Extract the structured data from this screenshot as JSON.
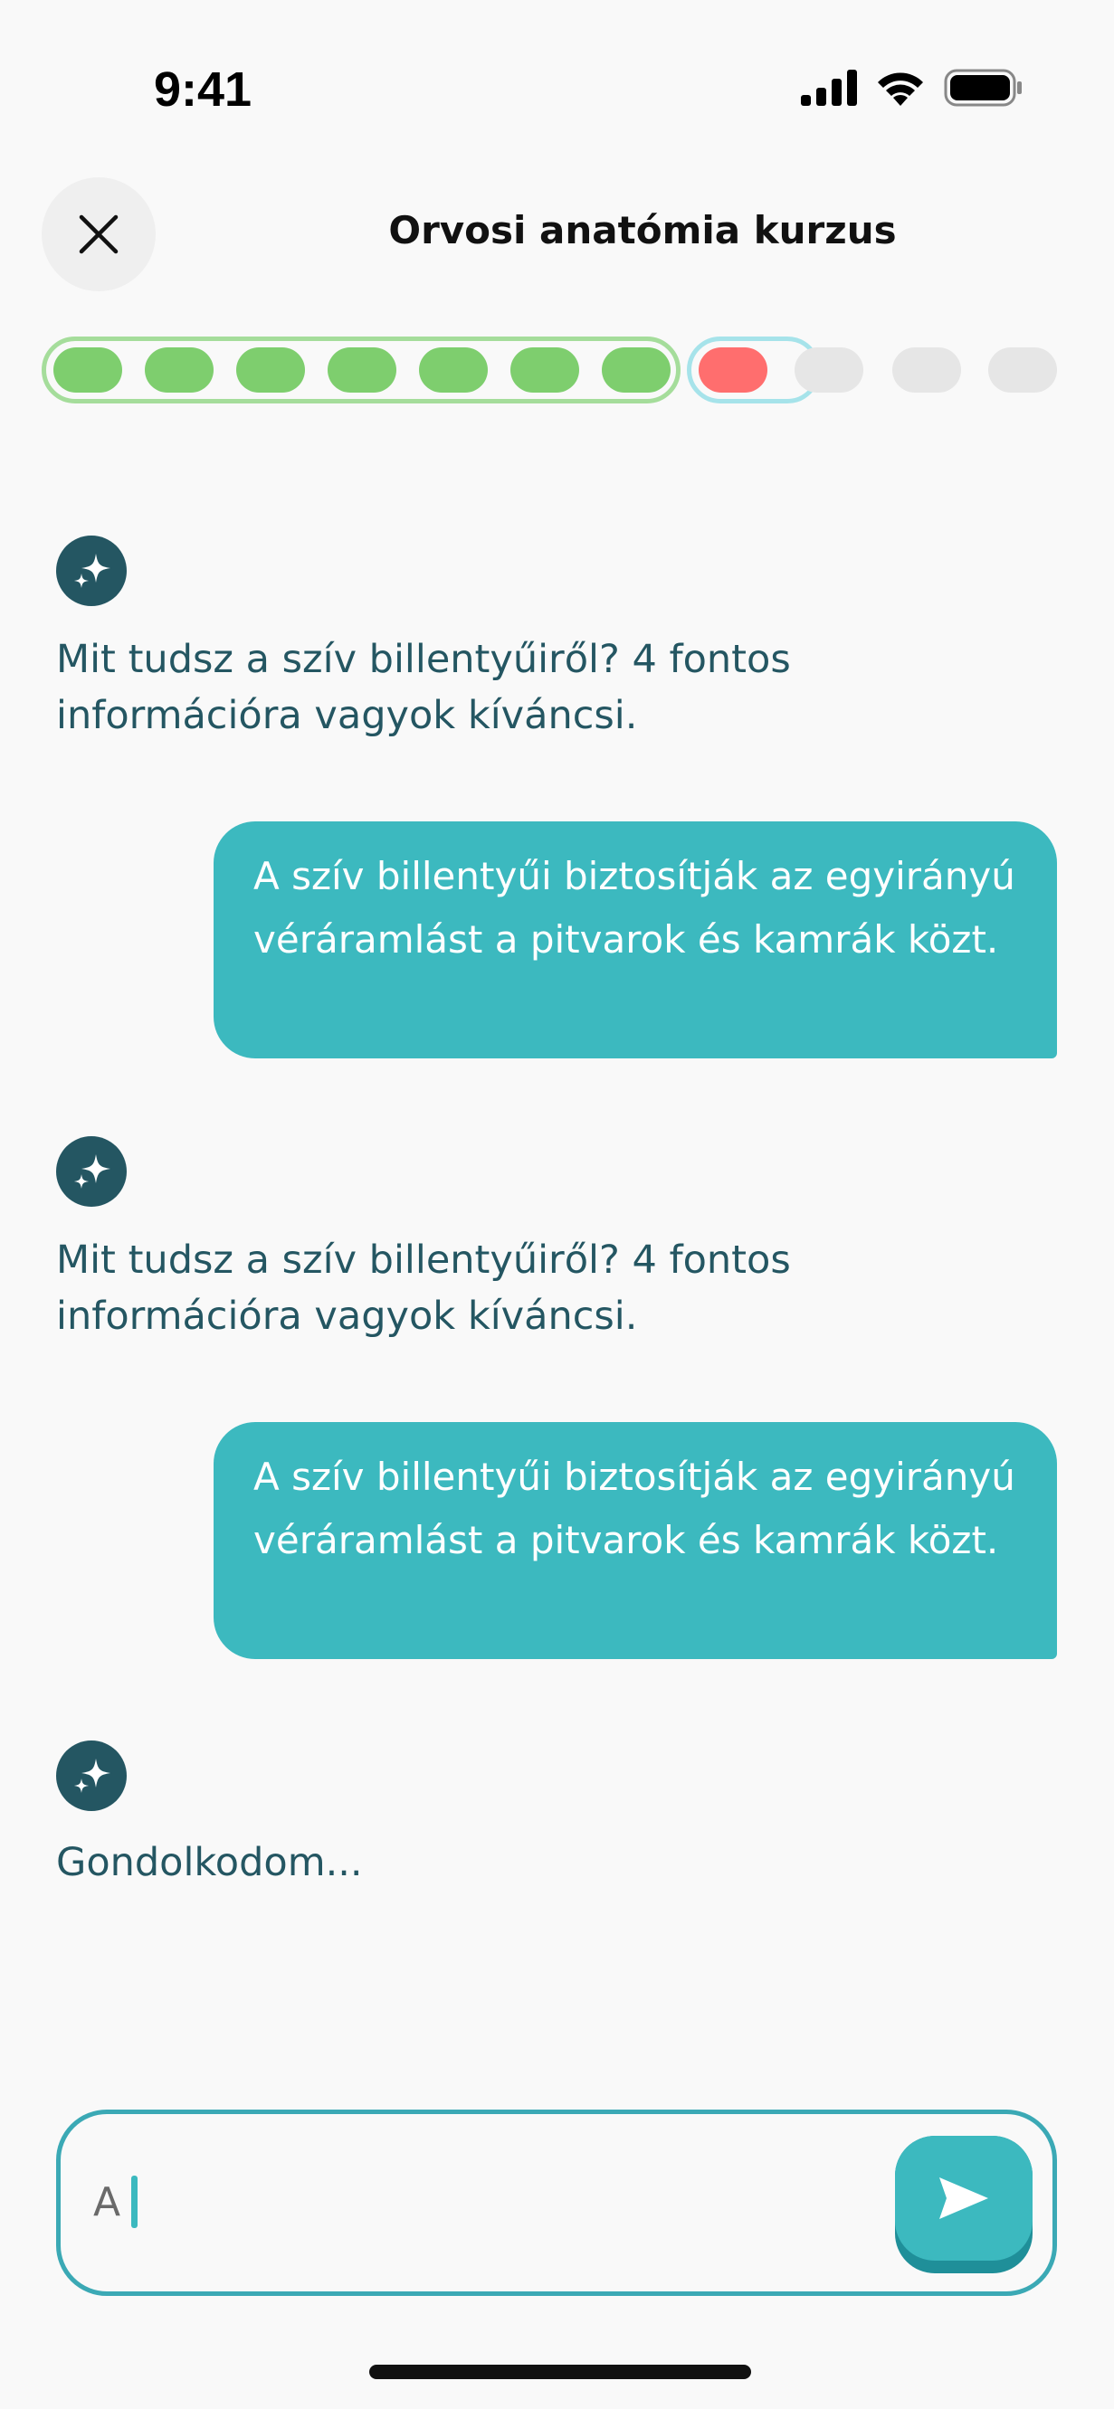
{
  "status_bar": {
    "time": "9:41"
  },
  "header": {
    "title": "Orvosi anatómia kurzus"
  },
  "progress": {
    "total": 11,
    "completed": 7,
    "current": 8,
    "current_state": "wrong"
  },
  "chat": {
    "messages": [
      {
        "role": "bot",
        "text": "Mit tudsz a szív billentyűiről? 4 fontos információra vagyok kíváncsi."
      },
      {
        "role": "user",
        "text": "A szív billentyűi biztosítják az egyirányú véráramlást a pitvarok és kamrák közt."
      },
      {
        "role": "bot",
        "text": "Mit tudsz a szív billentyűiről? 4 fontos információra vagyok kíváncsi."
      },
      {
        "role": "user",
        "text": "A szív billentyűi biztosítják az egyirányú véráramlást a pitvarok és kamrák közt."
      },
      {
        "role": "bot",
        "text": "Gondolkodom..."
      }
    ]
  },
  "input": {
    "value": "A"
  },
  "icons": {
    "close": "close-icon",
    "bot": "sparkle-icon",
    "send": "send-icon",
    "signal": "cellular-signal-icon",
    "wifi": "wifi-icon",
    "battery": "battery-icon"
  },
  "colors": {
    "accent": "#3cb9bf",
    "text": "#245662",
    "progress_done": "#7ece6e",
    "progress_wrong": "#ff6e6e",
    "progress_todo": "#e6e6e6"
  }
}
